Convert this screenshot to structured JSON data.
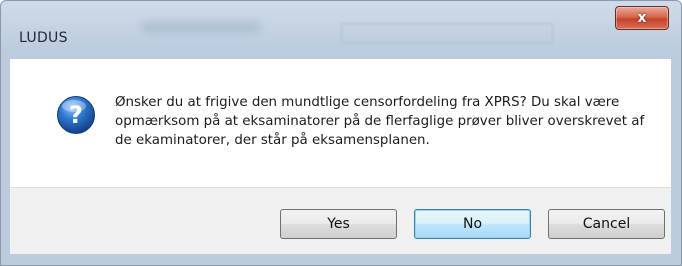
{
  "window": {
    "title": "LUDUS",
    "close_label": "x"
  },
  "dialog": {
    "icon": "question-icon",
    "message": "Ønsker du at frigive den mundtlige censorfordeling fra XPRS? Du skal være opmærksom på at eksaminatorer på de flerfaglige prøver bliver overskrevet af de ekaminatorer, der står på eksamensplanen."
  },
  "buttons": {
    "yes": "Yes",
    "no": "No",
    "cancel": "Cancel"
  },
  "colors": {
    "close_button": "#c7432b",
    "icon_blue": "#1f5fae",
    "frame": "#bccbde"
  }
}
